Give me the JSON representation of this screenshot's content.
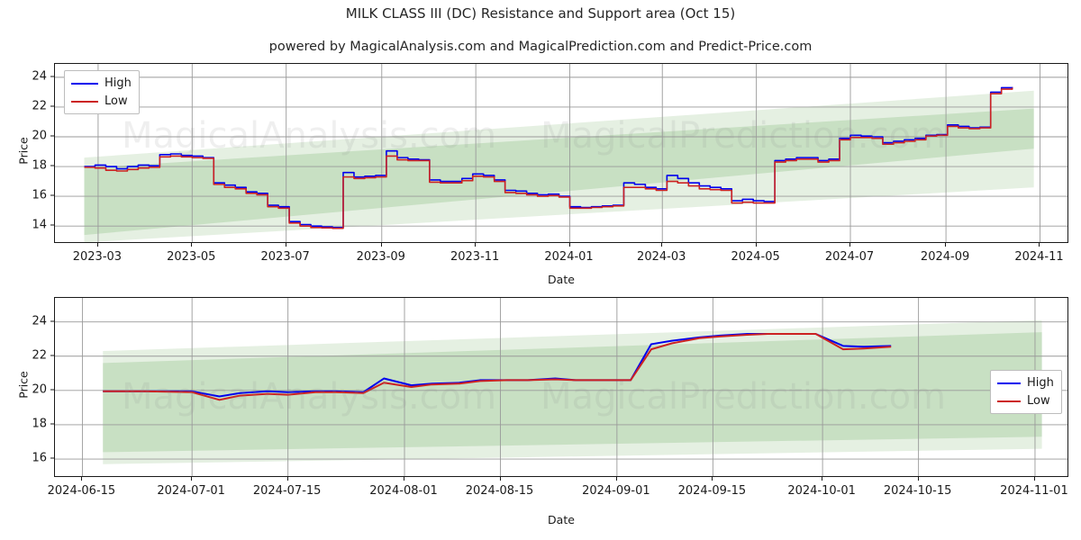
{
  "header": {
    "title": "MILK CLASS III (DC) Resistance and Support area (Oct 15)",
    "subtitle": "powered by MagicalAnalysis.com and MagicalPrediction.com and Predict-Price.com"
  },
  "watermarks": [
    "MagicalAnalysis.com",
    "MagicalPrediction.com",
    "MagicalAnalysis.com",
    "MagicalPrediction.com"
  ],
  "colors": {
    "high": "#0000ee",
    "low": "#cc2222",
    "band_outer": "#cfe3cb",
    "band_inner": "#bcd8b6",
    "grid": "#9a9a9a",
    "axis": "#1a1a1a",
    "watermark": "#8a8a8a"
  },
  "chart_data": [
    {
      "id": "upper",
      "type": "line",
      "title": "MILK CLASS III (DC) Resistance and Support area (Oct 15)",
      "xlabel": "Date",
      "ylabel": "Price",
      "grid": true,
      "legend_position": "upper-left",
      "xlim": [
        "2023-02-01",
        "2024-11-20"
      ],
      "ylim": [
        12.8,
        24.9
      ],
      "yticks": [
        14,
        16,
        18,
        20,
        22,
        24
      ],
      "xticks": [
        "2023-03",
        "2023-05",
        "2023-07",
        "2023-09",
        "2023-11",
        "2024-01",
        "2024-03",
        "2024-05",
        "2024-07",
        "2024-09",
        "2024-11"
      ],
      "series": [
        {
          "name": "High",
          "color": "#0000ee",
          "x": [
            "2023-02-20",
            "2023-02-27",
            "2023-03-06",
            "2023-03-13",
            "2023-03-20",
            "2023-03-27",
            "2023-04-03",
            "2023-04-10",
            "2023-04-17",
            "2023-04-24",
            "2023-05-01",
            "2023-05-08",
            "2023-05-15",
            "2023-05-22",
            "2023-05-29",
            "2023-06-05",
            "2023-06-12",
            "2023-06-19",
            "2023-06-26",
            "2023-07-03",
            "2023-07-10",
            "2023-07-17",
            "2023-07-24",
            "2023-07-31",
            "2023-08-07",
            "2023-08-14",
            "2023-08-21",
            "2023-08-28",
            "2023-09-04",
            "2023-09-11",
            "2023-09-18",
            "2023-09-25",
            "2023-10-02",
            "2023-10-09",
            "2023-10-16",
            "2023-10-23",
            "2023-10-30",
            "2023-11-06",
            "2023-11-13",
            "2023-11-20",
            "2023-11-27",
            "2023-12-04",
            "2023-12-11",
            "2023-12-18",
            "2023-12-25",
            "2024-01-01",
            "2024-01-08",
            "2024-01-15",
            "2024-01-22",
            "2024-01-29",
            "2024-02-05",
            "2024-02-12",
            "2024-02-19",
            "2024-02-26",
            "2024-03-04",
            "2024-03-11",
            "2024-03-18",
            "2024-03-25",
            "2024-04-01",
            "2024-04-08",
            "2024-04-15",
            "2024-04-22",
            "2024-04-29",
            "2024-05-06",
            "2024-05-13",
            "2024-05-20",
            "2024-05-27",
            "2024-06-03",
            "2024-06-10",
            "2024-06-17",
            "2024-06-24",
            "2024-07-01",
            "2024-07-08",
            "2024-07-15",
            "2024-07-22",
            "2024-07-29",
            "2024-08-05",
            "2024-08-12",
            "2024-08-19",
            "2024-08-26",
            "2024-09-02",
            "2024-09-09",
            "2024-09-16",
            "2024-09-23",
            "2024-09-30",
            "2024-10-07",
            "2024-10-14"
          ],
          "values": [
            18.0,
            18.1,
            18.0,
            17.85,
            18.0,
            18.1,
            18.05,
            18.8,
            18.85,
            18.75,
            18.7,
            18.6,
            16.9,
            16.75,
            16.6,
            16.3,
            16.2,
            15.4,
            15.3,
            14.3,
            14.1,
            14.0,
            13.95,
            13.9,
            17.6,
            17.3,
            17.35,
            17.4,
            19.05,
            18.6,
            18.5,
            18.45,
            17.1,
            17.0,
            17.0,
            17.2,
            17.5,
            17.4,
            17.1,
            16.4,
            16.35,
            16.2,
            16.1,
            16.15,
            16.0,
            15.3,
            15.25,
            15.3,
            15.35,
            15.4,
            16.9,
            16.8,
            16.6,
            16.5,
            17.4,
            17.2,
            16.9,
            16.7,
            16.6,
            16.5,
            15.7,
            15.8,
            15.7,
            15.65,
            18.4,
            18.5,
            18.6,
            18.6,
            18.4,
            18.5,
            19.9,
            20.1,
            20.05,
            20.0,
            19.6,
            19.7,
            19.8,
            19.9,
            20.1,
            20.15,
            20.8,
            20.7,
            20.6,
            20.65,
            23.0,
            23.3,
            23.35,
            22.6
          ],
          "style": "step"
        },
        {
          "name": "Low",
          "color": "#cc2222",
          "x": [
            "2023-02-20",
            "2023-02-27",
            "2023-03-06",
            "2023-03-13",
            "2023-03-20",
            "2023-03-27",
            "2023-04-03",
            "2023-04-10",
            "2023-04-17",
            "2023-04-24",
            "2023-05-01",
            "2023-05-08",
            "2023-05-15",
            "2023-05-22",
            "2023-05-29",
            "2023-06-05",
            "2023-06-12",
            "2023-06-19",
            "2023-06-26",
            "2023-07-03",
            "2023-07-10",
            "2023-07-17",
            "2023-07-24",
            "2023-07-31",
            "2023-08-07",
            "2023-08-14",
            "2023-08-21",
            "2023-08-28",
            "2023-09-04",
            "2023-09-11",
            "2023-09-18",
            "2023-09-25",
            "2023-10-02",
            "2023-10-09",
            "2023-10-16",
            "2023-10-23",
            "2023-10-30",
            "2023-11-06",
            "2023-11-13",
            "2023-11-20",
            "2023-11-27",
            "2023-12-04",
            "2023-12-11",
            "2023-12-18",
            "2023-12-25",
            "2024-01-01",
            "2024-01-08",
            "2024-01-15",
            "2024-01-22",
            "2024-01-29",
            "2024-02-05",
            "2024-02-12",
            "2024-02-19",
            "2024-02-26",
            "2024-03-04",
            "2024-03-11",
            "2024-03-18",
            "2024-03-25",
            "2024-04-01",
            "2024-04-08",
            "2024-04-15",
            "2024-04-22",
            "2024-04-29",
            "2024-05-06",
            "2024-05-13",
            "2024-05-20",
            "2024-05-27",
            "2024-06-03",
            "2024-06-10",
            "2024-06-17",
            "2024-06-24",
            "2024-07-01",
            "2024-07-08",
            "2024-07-15",
            "2024-07-22",
            "2024-07-29",
            "2024-08-05",
            "2024-08-12",
            "2024-08-19",
            "2024-08-26",
            "2024-09-02",
            "2024-09-09",
            "2024-09-16",
            "2024-09-23",
            "2024-09-30",
            "2024-10-07",
            "2024-10-14"
          ],
          "values": [
            17.95,
            17.9,
            17.75,
            17.7,
            17.8,
            17.9,
            17.95,
            18.65,
            18.7,
            18.65,
            18.6,
            18.55,
            16.8,
            16.6,
            16.5,
            16.2,
            16.1,
            15.3,
            15.2,
            14.2,
            14.0,
            13.9,
            13.88,
            13.85,
            17.3,
            17.2,
            17.25,
            17.3,
            18.7,
            18.45,
            18.4,
            18.4,
            16.95,
            16.9,
            16.9,
            17.05,
            17.35,
            17.3,
            17.0,
            16.25,
            16.2,
            16.1,
            16.0,
            16.05,
            15.95,
            15.2,
            15.2,
            15.25,
            15.3,
            15.35,
            16.6,
            16.6,
            16.5,
            16.4,
            17.0,
            16.9,
            16.7,
            16.5,
            16.45,
            16.4,
            15.55,
            15.6,
            15.55,
            15.55,
            18.3,
            18.4,
            18.5,
            18.5,
            18.3,
            18.4,
            19.8,
            19.95,
            19.95,
            19.9,
            19.5,
            19.6,
            19.7,
            19.8,
            20.05,
            20.1,
            20.7,
            20.6,
            20.55,
            20.6,
            22.9,
            23.2,
            23.3,
            22.55
          ],
          "style": "step"
        }
      ],
      "bands": [
        {
          "name": "outer-resistance-support",
          "color": "#cfe3cb",
          "opacity": 0.55,
          "x_start": "2023-02-20",
          "x_end": "2024-10-28",
          "upper_start": 18.6,
          "upper_end": 23.1,
          "lower_start": 12.9,
          "lower_end": 16.6
        },
        {
          "name": "inner-resistance-support",
          "color": "#bcd8b6",
          "opacity": 0.7,
          "x_start": "2023-02-20",
          "x_end": "2024-10-28",
          "upper_start": 17.9,
          "upper_end": 21.9,
          "lower_start": 13.4,
          "lower_end": 19.2
        }
      ]
    },
    {
      "id": "lower",
      "type": "line",
      "xlabel": "Date",
      "ylabel": "Price",
      "grid": true,
      "legend_position": "lower-right",
      "xlim": [
        "2024-06-11",
        "2024-11-06"
      ],
      "ylim": [
        14.9,
        25.4
      ],
      "yticks": [
        16,
        18,
        20,
        22,
        24
      ],
      "xticks": [
        "2024-06-15",
        "2024-07-01",
        "2024-07-15",
        "2024-08-01",
        "2024-08-15",
        "2024-09-01",
        "2024-09-15",
        "2024-10-01",
        "2024-10-15",
        "2024-11-01"
      ],
      "series": [
        {
          "name": "High",
          "color": "#0000ee",
          "x": [
            "2024-06-18",
            "2024-06-24",
            "2024-07-01",
            "2024-07-05",
            "2024-07-08",
            "2024-07-12",
            "2024-07-15",
            "2024-07-19",
            "2024-07-22",
            "2024-07-26",
            "2024-07-29",
            "2024-08-02",
            "2024-08-05",
            "2024-08-09",
            "2024-08-12",
            "2024-08-16",
            "2024-08-19",
            "2024-08-23",
            "2024-08-26",
            "2024-08-30",
            "2024-09-03",
            "2024-09-06",
            "2024-09-09",
            "2024-09-13",
            "2024-09-16",
            "2024-09-20",
            "2024-09-23",
            "2024-09-27",
            "2024-09-30",
            "2024-10-04",
            "2024-10-07",
            "2024-10-11"
          ],
          "values": [
            19.95,
            19.95,
            19.95,
            19.65,
            19.85,
            19.95,
            19.9,
            19.95,
            19.95,
            19.9,
            20.7,
            20.3,
            20.4,
            20.45,
            20.6,
            20.6,
            20.6,
            20.7,
            20.6,
            20.6,
            20.6,
            22.7,
            22.9,
            23.1,
            23.2,
            23.3,
            23.3,
            23.3,
            23.3,
            22.6,
            22.55,
            22.6
          ],
          "style": "line"
        },
        {
          "name": "Low",
          "color": "#cc2222",
          "x": [
            "2024-06-18",
            "2024-06-24",
            "2024-07-01",
            "2024-07-05",
            "2024-07-08",
            "2024-07-12",
            "2024-07-15",
            "2024-07-19",
            "2024-07-22",
            "2024-07-26",
            "2024-07-29",
            "2024-08-02",
            "2024-08-05",
            "2024-08-09",
            "2024-08-12",
            "2024-08-16",
            "2024-08-19",
            "2024-08-23",
            "2024-08-26",
            "2024-08-30",
            "2024-09-03",
            "2024-09-06",
            "2024-09-09",
            "2024-09-13",
            "2024-09-16",
            "2024-09-20",
            "2024-09-23",
            "2024-09-27",
            "2024-09-30",
            "2024-10-04",
            "2024-10-07",
            "2024-10-11"
          ],
          "values": [
            19.95,
            19.95,
            19.9,
            19.45,
            19.7,
            19.8,
            19.75,
            19.9,
            19.9,
            19.85,
            20.45,
            20.2,
            20.35,
            20.4,
            20.55,
            20.6,
            20.6,
            20.65,
            20.6,
            20.6,
            20.6,
            22.4,
            22.75,
            23.05,
            23.15,
            23.25,
            23.3,
            23.3,
            23.3,
            22.4,
            22.45,
            22.55
          ],
          "style": "line"
        }
      ],
      "bands": [
        {
          "name": "outer-resistance-support",
          "color": "#cfe3cb",
          "opacity": 0.55,
          "x_start": "2024-06-18",
          "x_end": "2024-11-02",
          "upper_start": 22.3,
          "upper_end": 24.1,
          "lower_start": 15.7,
          "lower_end": 16.6
        },
        {
          "name": "inner-resistance-support",
          "color": "#bcd8b6",
          "opacity": 0.7,
          "x_start": "2024-06-18",
          "x_end": "2024-11-02",
          "upper_start": 21.6,
          "upper_end": 23.4,
          "lower_start": 16.4,
          "lower_end": 17.3
        }
      ]
    }
  ]
}
